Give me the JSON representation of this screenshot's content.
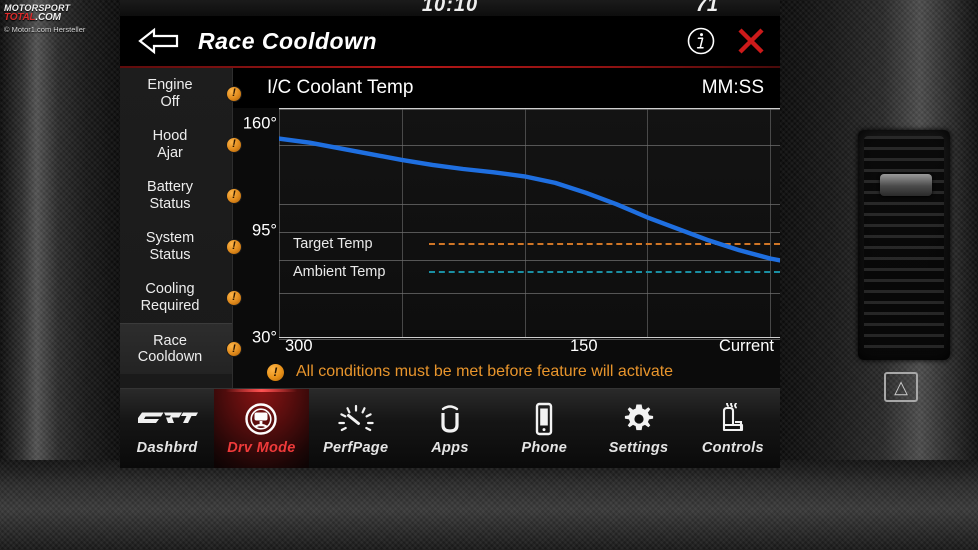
{
  "watermark": {
    "line1": "MOTORSPORT",
    "line2_red": "TOTAL",
    "line2_rest": ".COM",
    "line3": "© Motor1.com Hersteller"
  },
  "statusbar": {
    "clock": "10:10",
    "temperature": "71"
  },
  "header": {
    "title": "Race Cooldown",
    "back_icon": "back-arrow-icon",
    "info_icon": "info-icon",
    "close_icon": "close-x-icon",
    "accent_color": "#b21717"
  },
  "sidebar": {
    "items": [
      {
        "label": "Engine\nOff",
        "badge": "!",
        "selected": false
      },
      {
        "label": "Hood\nAjar",
        "badge": "!",
        "selected": false
      },
      {
        "label": "Battery\nStatus",
        "badge": "!",
        "selected": false
      },
      {
        "label": "System\nStatus",
        "badge": "!",
        "selected": false
      },
      {
        "label": "Cooling\nRequired",
        "badge": "!",
        "selected": false
      },
      {
        "label": "Race\nCooldown",
        "badge": "!",
        "selected": true
      }
    ],
    "badge_color": "#e08a1c"
  },
  "chart_header": {
    "title": "I/C Coolant Temp",
    "timer": "MM:SS"
  },
  "footer_warning": {
    "badge": "!",
    "text": "All conditions must be met before feature will activate",
    "color": "#e8952c"
  },
  "navbar": {
    "items": [
      {
        "label": "Dashbrd",
        "icon": "srt-logo-icon",
        "active": false
      },
      {
        "label": "Drv Mode",
        "icon": "steering-wheel-icon",
        "active": true
      },
      {
        "label": "PerfPage",
        "icon": "gauge-icon",
        "active": false
      },
      {
        "label": "Apps",
        "icon": "uconnect-logo-icon",
        "active": false
      },
      {
        "label": "Phone",
        "icon": "phone-icon",
        "active": false
      },
      {
        "label": "Settings",
        "icon": "gear-icon",
        "active": false
      },
      {
        "label": "Controls",
        "icon": "heated-seat-icon",
        "active": false
      }
    ],
    "active_color": "#ef3a3a"
  },
  "chart_data": {
    "type": "line",
    "title": "I/C Coolant Temp",
    "xlabel": "",
    "ylabel": "",
    "xlim": [
      300,
      0
    ],
    "ylim": [
      30,
      170
    ],
    "ytick_labels": [
      "160°",
      "95°",
      "30°"
    ],
    "ytick_values": [
      160,
      95,
      30
    ],
    "xtick_labels": [
      "300",
      "150",
      "Current"
    ],
    "xtick_values": [
      300,
      150,
      0
    ],
    "grid": true,
    "gridlines_y": [
      170,
      148,
      112,
      95,
      78,
      58,
      30
    ],
    "gridlines_x": [
      300,
      240,
      180,
      120,
      60,
      0
    ],
    "series": [
      {
        "name": "I/C Coolant Temp",
        "color": "#1f6fe0",
        "style": "solid",
        "x": [
          300,
          285,
          270,
          255,
          240,
          225,
          210,
          195,
          180,
          165,
          150,
          135,
          120,
          105,
          90,
          75,
          60,
          45,
          30,
          15,
          0
        ],
        "y": [
          152,
          149.5,
          146,
          142.5,
          139,
          136,
          133.5,
          131.5,
          129,
          125,
          119,
          112,
          104,
          97,
          90,
          84,
          79,
          75.5,
          73,
          71.8,
          71
        ]
      },
      {
        "name": "Target Temp",
        "color": "#cf7526",
        "style": "dashed",
        "value": 88
      },
      {
        "name": "Ambient Temp",
        "color": "#1a8fa3",
        "style": "dashed",
        "value": 71
      }
    ],
    "cursor": {
      "label": "Current",
      "x": 0,
      "y": 71,
      "color": "#2a6fd6"
    },
    "legend_position": "inline-left",
    "legend": [
      "Target Temp",
      "Ambient Temp"
    ]
  }
}
